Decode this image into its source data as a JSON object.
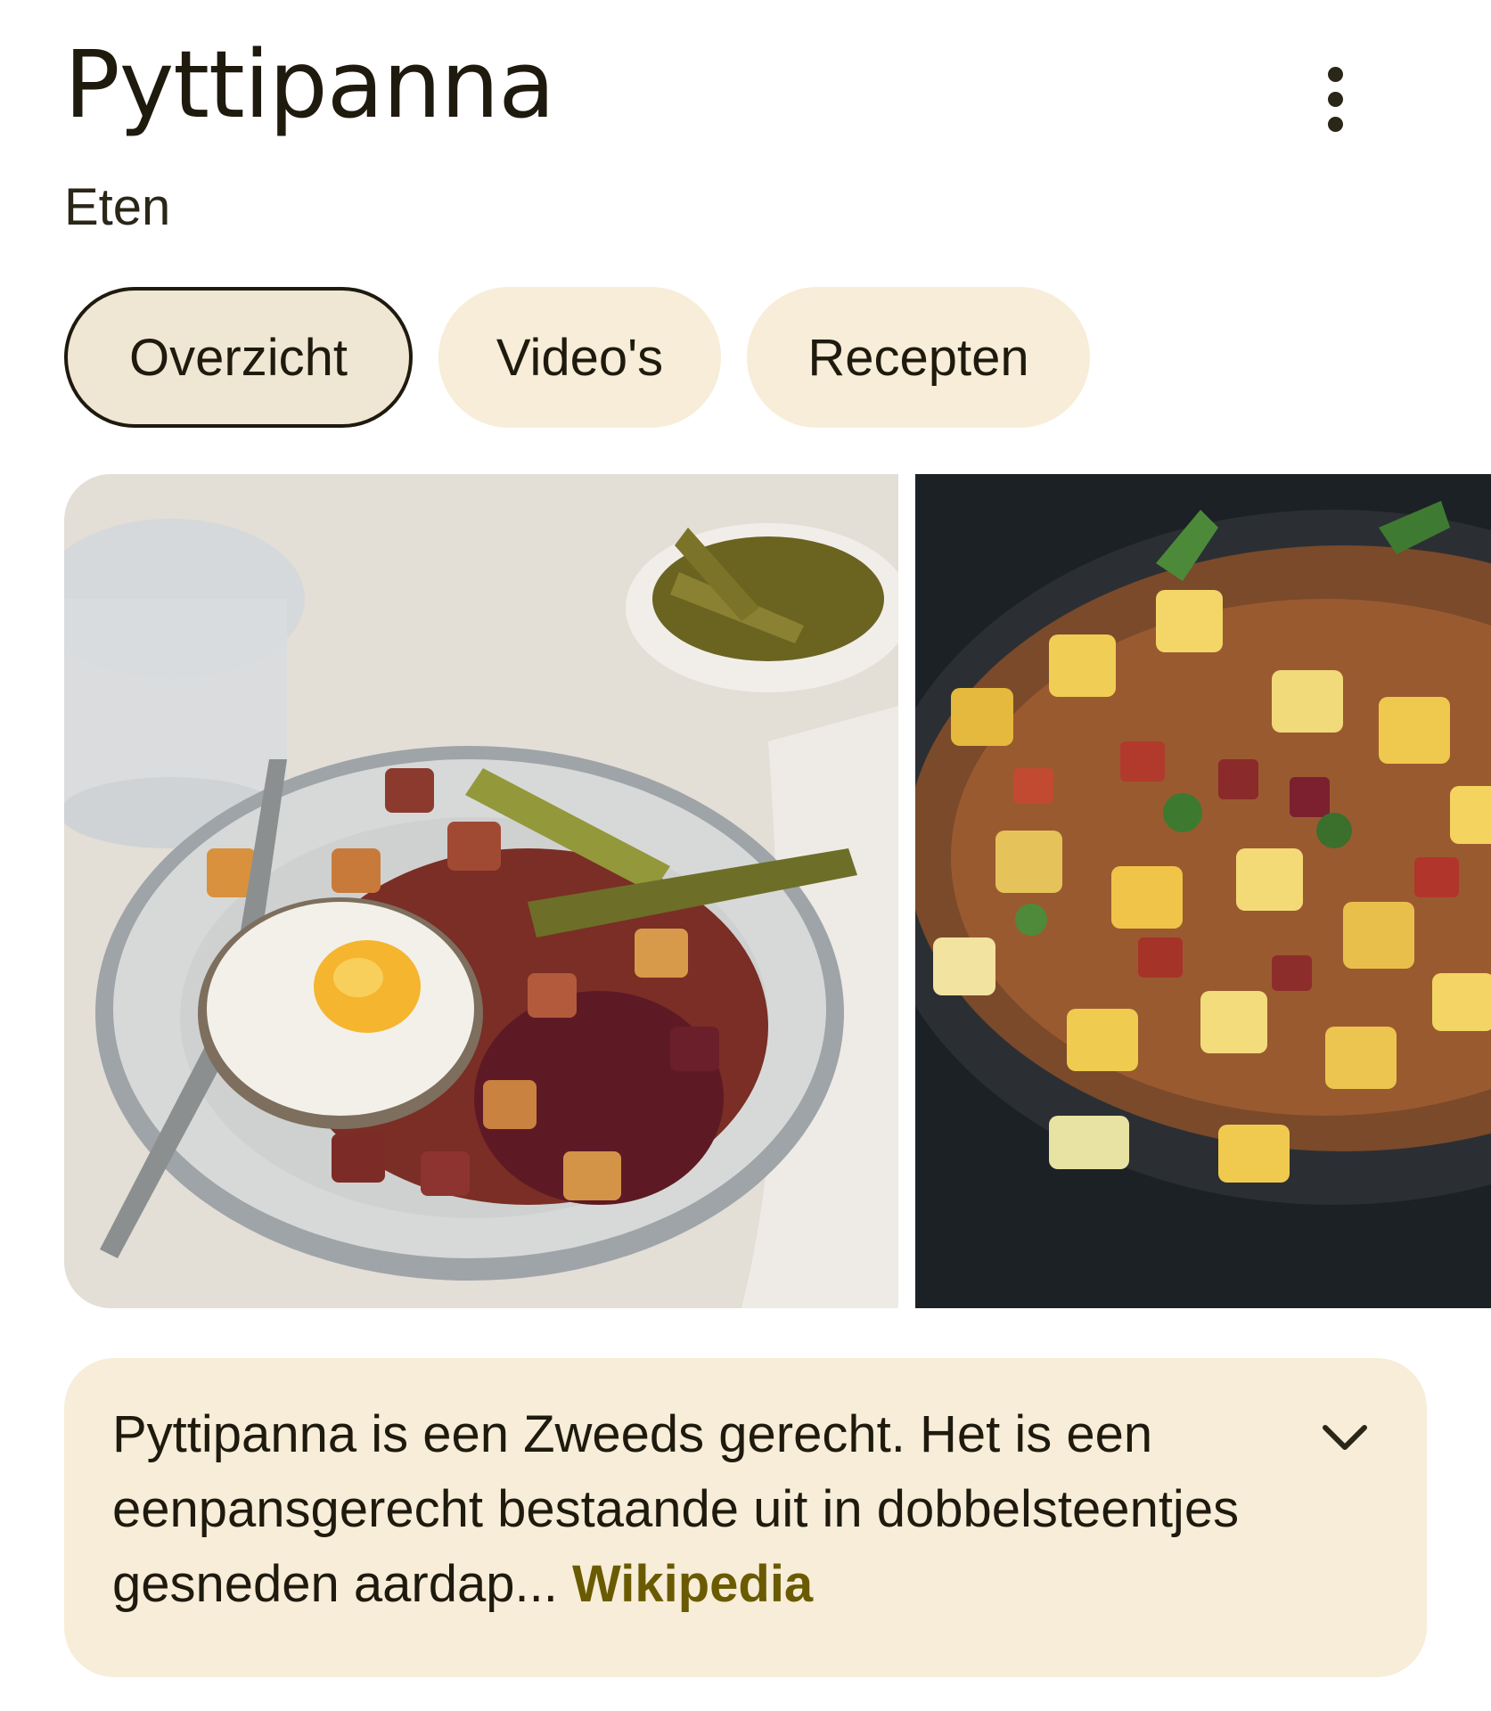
{
  "header": {
    "title": "Pyttipanna",
    "subtitle": "Eten",
    "more_icon": "more-vert-icon"
  },
  "tabs": [
    {
      "label": "Overzicht",
      "selected": true
    },
    {
      "label": "Video's",
      "selected": false
    },
    {
      "label": "Recepten",
      "selected": false
    }
  ],
  "gallery": {
    "images": [
      {
        "alt": "Pyttipanna on a plate with fried egg and pickles"
      },
      {
        "alt": "Pyttipanna in a cast-iron pan"
      }
    ]
  },
  "description": {
    "text": "Pyttipanna is een Zweeds gerecht. Het is een eenpansgerecht bestaande uit in dobbelsteentjes gesneden aardap...",
    "source": "Wikipedia",
    "expand_icon": "chevron-down-icon"
  },
  "colors": {
    "chip_bg": "#f7edd8",
    "card_bg": "#f7edd8",
    "link": "#6a5b00",
    "text": "#1f1a0e"
  }
}
